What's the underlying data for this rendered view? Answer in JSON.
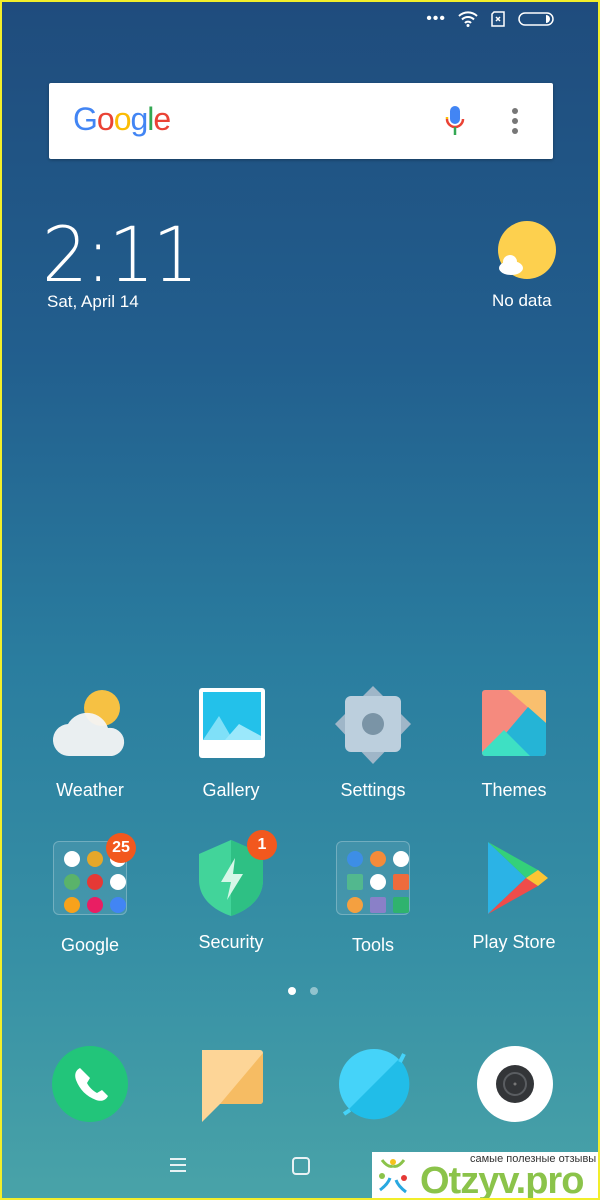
{
  "status_bar": {
    "icons": [
      "more-dots-icon",
      "wifi-icon",
      "no-sim-icon",
      "battery-icon"
    ]
  },
  "search": {
    "logo": "Google",
    "icons": [
      "mic-icon",
      "overflow-menu-icon"
    ]
  },
  "clock": {
    "time": "2:11",
    "date": "Sat, April 14"
  },
  "weather_widget": {
    "text": "No data",
    "icon": "partly-cloudy-icon"
  },
  "apps": [
    {
      "label": "Weather"
    },
    {
      "label": "Gallery"
    },
    {
      "label": "Settings"
    },
    {
      "label": "Themes"
    },
    {
      "label": "Google",
      "badge": "25"
    },
    {
      "label": "Security",
      "badge": "1"
    },
    {
      "label": "Tools"
    },
    {
      "label": "Play Store"
    }
  ],
  "page_indicator": {
    "pages": 2,
    "current": 1
  },
  "dock": [
    "phone",
    "messages",
    "browser",
    "camera"
  ],
  "nav": [
    "menu-icon",
    "home-icon",
    "back-icon"
  ],
  "watermark": {
    "tagline": "самые полезные отзывы",
    "brand": "Otzyv.pro"
  },
  "colors": {
    "badge": "#f2581e",
    "wallpaper_top": "#1f4c7d",
    "wallpaper_bottom": "#49a3a8"
  }
}
